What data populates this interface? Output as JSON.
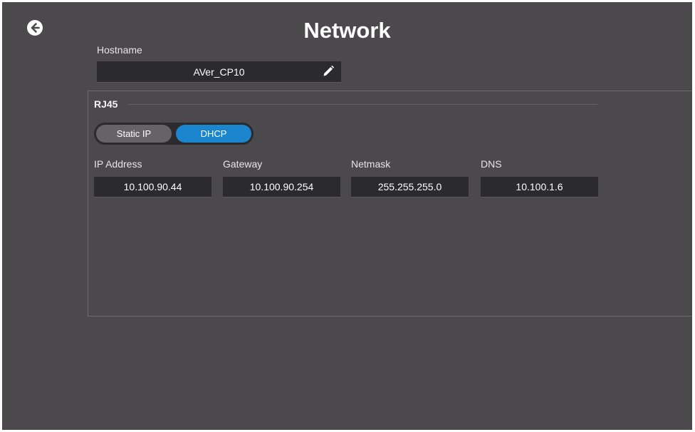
{
  "header": {
    "title": "Network"
  },
  "icons": {
    "back": "arrow-left-circle-icon",
    "edit": "pencil-icon"
  },
  "hostname": {
    "label": "Hostname",
    "value": "AVer_CP10"
  },
  "rj45": {
    "title": "RJ45",
    "mode_toggle": {
      "options": [
        "Static IP",
        "DHCP"
      ],
      "selected": "DHCP"
    },
    "fields": [
      {
        "label": "IP Address",
        "value": "10.100.90.44"
      },
      {
        "label": "Gateway",
        "value": "10.100.90.254"
      },
      {
        "label": "Netmask",
        "value": "255.255.255.0"
      },
      {
        "label": "DNS",
        "value": "10.100.1.6"
      }
    ]
  },
  "colors": {
    "background": "#4b494b",
    "field_background": "#2b2a2c",
    "accent": "#1b86cd"
  }
}
